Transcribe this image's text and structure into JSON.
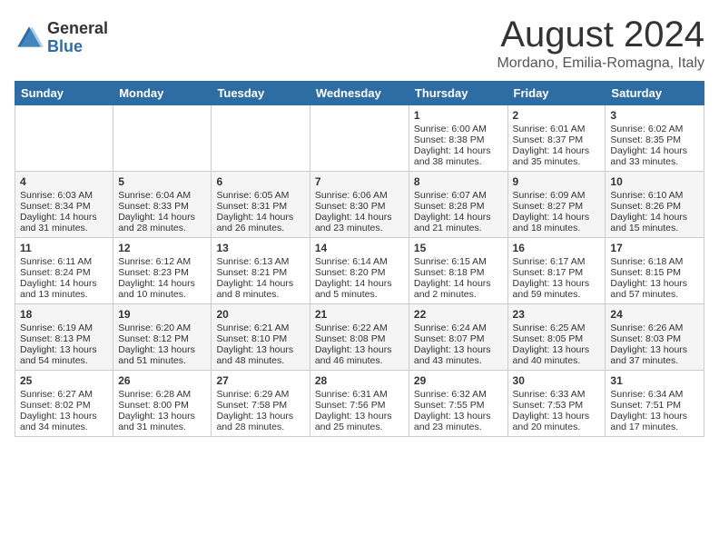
{
  "header": {
    "title": "August 2024",
    "location": "Mordano, Emilia-Romagna, Italy",
    "logo_general": "General",
    "logo_blue": "Blue"
  },
  "days_of_week": [
    "Sunday",
    "Monday",
    "Tuesday",
    "Wednesday",
    "Thursday",
    "Friday",
    "Saturday"
  ],
  "weeks": [
    [
      {
        "day": "",
        "info": ""
      },
      {
        "day": "",
        "info": ""
      },
      {
        "day": "",
        "info": ""
      },
      {
        "day": "",
        "info": ""
      },
      {
        "day": "1",
        "info": "Sunrise: 6:00 AM\nSunset: 8:38 PM\nDaylight: 14 hours\nand 38 minutes."
      },
      {
        "day": "2",
        "info": "Sunrise: 6:01 AM\nSunset: 8:37 PM\nDaylight: 14 hours\nand 35 minutes."
      },
      {
        "day": "3",
        "info": "Sunrise: 6:02 AM\nSunset: 8:35 PM\nDaylight: 14 hours\nand 33 minutes."
      }
    ],
    [
      {
        "day": "4",
        "info": "Sunrise: 6:03 AM\nSunset: 8:34 PM\nDaylight: 14 hours\nand 31 minutes."
      },
      {
        "day": "5",
        "info": "Sunrise: 6:04 AM\nSunset: 8:33 PM\nDaylight: 14 hours\nand 28 minutes."
      },
      {
        "day": "6",
        "info": "Sunrise: 6:05 AM\nSunset: 8:31 PM\nDaylight: 14 hours\nand 26 minutes."
      },
      {
        "day": "7",
        "info": "Sunrise: 6:06 AM\nSunset: 8:30 PM\nDaylight: 14 hours\nand 23 minutes."
      },
      {
        "day": "8",
        "info": "Sunrise: 6:07 AM\nSunset: 8:28 PM\nDaylight: 14 hours\nand 21 minutes."
      },
      {
        "day": "9",
        "info": "Sunrise: 6:09 AM\nSunset: 8:27 PM\nDaylight: 14 hours\nand 18 minutes."
      },
      {
        "day": "10",
        "info": "Sunrise: 6:10 AM\nSunset: 8:26 PM\nDaylight: 14 hours\nand 15 minutes."
      }
    ],
    [
      {
        "day": "11",
        "info": "Sunrise: 6:11 AM\nSunset: 8:24 PM\nDaylight: 14 hours\nand 13 minutes."
      },
      {
        "day": "12",
        "info": "Sunrise: 6:12 AM\nSunset: 8:23 PM\nDaylight: 14 hours\nand 10 minutes."
      },
      {
        "day": "13",
        "info": "Sunrise: 6:13 AM\nSunset: 8:21 PM\nDaylight: 14 hours\nand 8 minutes."
      },
      {
        "day": "14",
        "info": "Sunrise: 6:14 AM\nSunset: 8:20 PM\nDaylight: 14 hours\nand 5 minutes."
      },
      {
        "day": "15",
        "info": "Sunrise: 6:15 AM\nSunset: 8:18 PM\nDaylight: 14 hours\nand 2 minutes."
      },
      {
        "day": "16",
        "info": "Sunrise: 6:17 AM\nSunset: 8:17 PM\nDaylight: 13 hours\nand 59 minutes."
      },
      {
        "day": "17",
        "info": "Sunrise: 6:18 AM\nSunset: 8:15 PM\nDaylight: 13 hours\nand 57 minutes."
      }
    ],
    [
      {
        "day": "18",
        "info": "Sunrise: 6:19 AM\nSunset: 8:13 PM\nDaylight: 13 hours\nand 54 minutes."
      },
      {
        "day": "19",
        "info": "Sunrise: 6:20 AM\nSunset: 8:12 PM\nDaylight: 13 hours\nand 51 minutes."
      },
      {
        "day": "20",
        "info": "Sunrise: 6:21 AM\nSunset: 8:10 PM\nDaylight: 13 hours\nand 48 minutes."
      },
      {
        "day": "21",
        "info": "Sunrise: 6:22 AM\nSunset: 8:08 PM\nDaylight: 13 hours\nand 46 minutes."
      },
      {
        "day": "22",
        "info": "Sunrise: 6:24 AM\nSunset: 8:07 PM\nDaylight: 13 hours\nand 43 minutes."
      },
      {
        "day": "23",
        "info": "Sunrise: 6:25 AM\nSunset: 8:05 PM\nDaylight: 13 hours\nand 40 minutes."
      },
      {
        "day": "24",
        "info": "Sunrise: 6:26 AM\nSunset: 8:03 PM\nDaylight: 13 hours\nand 37 minutes."
      }
    ],
    [
      {
        "day": "25",
        "info": "Sunrise: 6:27 AM\nSunset: 8:02 PM\nDaylight: 13 hours\nand 34 minutes."
      },
      {
        "day": "26",
        "info": "Sunrise: 6:28 AM\nSunset: 8:00 PM\nDaylight: 13 hours\nand 31 minutes."
      },
      {
        "day": "27",
        "info": "Sunrise: 6:29 AM\nSunset: 7:58 PM\nDaylight: 13 hours\nand 28 minutes."
      },
      {
        "day": "28",
        "info": "Sunrise: 6:31 AM\nSunset: 7:56 PM\nDaylight: 13 hours\nand 25 minutes."
      },
      {
        "day": "29",
        "info": "Sunrise: 6:32 AM\nSunset: 7:55 PM\nDaylight: 13 hours\nand 23 minutes."
      },
      {
        "day": "30",
        "info": "Sunrise: 6:33 AM\nSunset: 7:53 PM\nDaylight: 13 hours\nand 20 minutes."
      },
      {
        "day": "31",
        "info": "Sunrise: 6:34 AM\nSunset: 7:51 PM\nDaylight: 13 hours\nand 17 minutes."
      }
    ]
  ]
}
